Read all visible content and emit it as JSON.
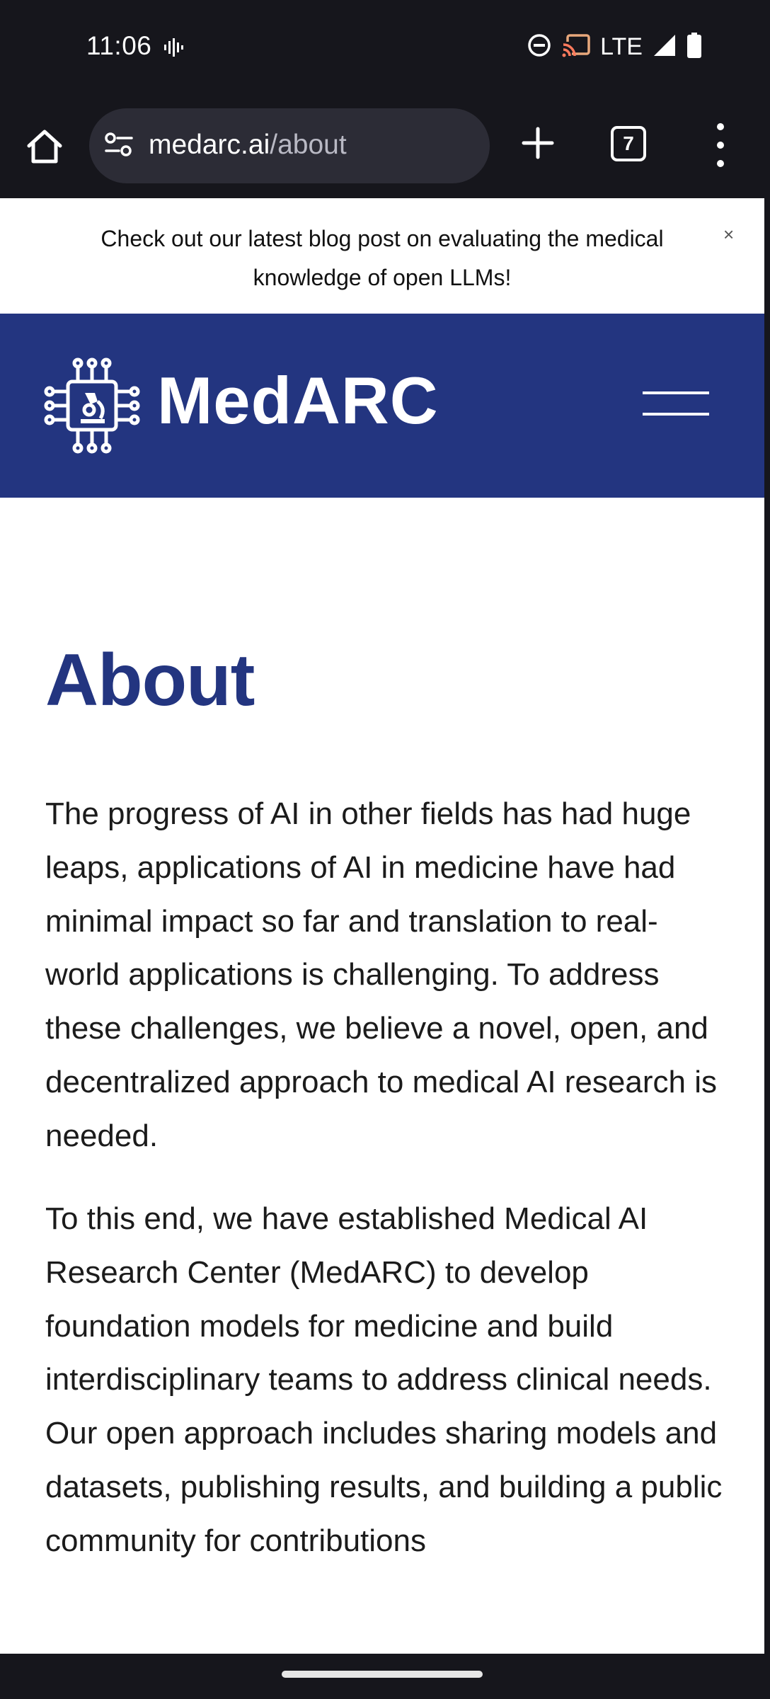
{
  "status_bar": {
    "time": "11:06",
    "network": "LTE"
  },
  "browser": {
    "url_host": "medarc.ai",
    "url_path": "/about",
    "tab_count": "7"
  },
  "banner": {
    "text": "Check out our latest blog post on evaluating the medical knowledge of open LLMs!",
    "close_label": "×"
  },
  "header": {
    "logo_text": "MedARC"
  },
  "main": {
    "title": "About",
    "paragraph_1": "The progress of AI in other fields has had huge leaps, applications of AI in medicine have had minimal impact so far and translation to real-world applications is challenging. To address these challenges, we believe a novel, open, and decentralized approach to medical AI research is needed.",
    "paragraph_2": "To this end, we have established Medical AI Research Center (MedARC) to develop foundation models for medicine and build interdisciplinary teams to address clinical needs. Our open approach includes sharing models and datasets, publishing results, and building a public community for contributions"
  },
  "colors": {
    "brand_navy": "#233580",
    "chrome_dark": "#16161c",
    "url_bar_bg": "#2c2c36"
  },
  "icons": [
    "waveform-icon",
    "do-not-disturb-icon",
    "cast-icon",
    "signal-icon",
    "battery-icon",
    "home-icon",
    "site-settings-icon",
    "plus-icon",
    "tabs-icon",
    "more-vert-icon",
    "close-icon",
    "chip-microscope-logo-icon",
    "hamburger-menu-icon"
  ]
}
